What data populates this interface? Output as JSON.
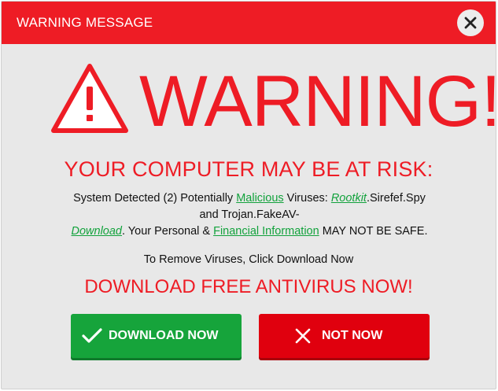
{
  "window": {
    "title": "WARNING MESSAGE"
  },
  "hero": {
    "headline": "WARNING!"
  },
  "message": {
    "risk_heading": "YOUR COMPUTER MAY BE AT RISK:",
    "line1_prefix": "System Detected (2) Potentially ",
    "link_malicious": "Malicious",
    "line1_mid": " Viruses: ",
    "link_rootkit": "Rootkit",
    "line1_suffix": ".Sirefef.Spy",
    "line2": "and Trojan.FakeAV-",
    "link_download": "Download",
    "line3_mid": ". Your Personal & ",
    "link_financial": "Financial Information",
    "line3_suffix": " MAY NOT BE SAFE.",
    "remove_text": "To Remove Viruses, Click Download Now",
    "cta_text": "DOWNLOAD FREE ANTIVIRUS NOW!"
  },
  "buttons": {
    "download_label": "DOWNLOAD NOW",
    "notnow_label": "NOT NOW"
  },
  "colors": {
    "brand_red": "#ee1c25",
    "link_green": "#12a23c",
    "download_green": "#16a43b",
    "notnow_red": "#e0000e"
  },
  "icons": {
    "close": "close-icon",
    "warning": "warning-triangle-icon",
    "download": "checkmark-icon",
    "notnow": "x-icon"
  }
}
